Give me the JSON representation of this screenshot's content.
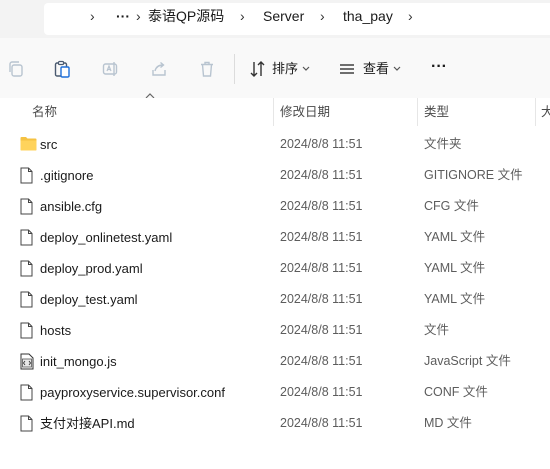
{
  "breadcrumb": {
    "more": "···",
    "items": [
      "泰语QP源码",
      "Server",
      "tha_pay"
    ]
  },
  "toolbar": {
    "sort_label": "排序",
    "view_label": "查看",
    "more": "···"
  },
  "columns": {
    "name": "名称",
    "date": "修改日期",
    "type": "类型",
    "size": "大"
  },
  "files": [
    {
      "name": "src",
      "date": "2024/8/8 11:51",
      "type": "文件夹",
      "icon": "folder-icon"
    },
    {
      "name": ".gitignore",
      "date": "2024/8/8 11:51",
      "type": "GITIGNORE 文件",
      "icon": "file-icon"
    },
    {
      "name": "ansible.cfg",
      "date": "2024/8/8 11:51",
      "type": "CFG 文件",
      "icon": "file-icon"
    },
    {
      "name": "deploy_onlinetest.yaml",
      "date": "2024/8/8 11:51",
      "type": "YAML 文件",
      "icon": "file-icon"
    },
    {
      "name": "deploy_prod.yaml",
      "date": "2024/8/8 11:51",
      "type": "YAML 文件",
      "icon": "file-icon"
    },
    {
      "name": "deploy_test.yaml",
      "date": "2024/8/8 11:51",
      "type": "YAML 文件",
      "icon": "file-icon"
    },
    {
      "name": "hosts",
      "date": "2024/8/8 11:51",
      "type": "文件",
      "icon": "file-icon"
    },
    {
      "name": "init_mongo.js",
      "date": "2024/8/8 11:51",
      "type": "JavaScript 文件",
      "icon": "script-file-icon"
    },
    {
      "name": "payproxyservice.supervisor.conf",
      "date": "2024/8/8 11:51",
      "type": "CONF 文件",
      "icon": "file-icon"
    },
    {
      "name": "支付对接API.md",
      "date": "2024/8/8 11:51",
      "type": "MD 文件",
      "icon": "file-icon"
    }
  ],
  "colors": {
    "folder": "#f5c242",
    "address_bg": "#f3f3f3",
    "toolbar_bg": "#f9f9f9",
    "disabled_icon": "#b8c4d0"
  }
}
